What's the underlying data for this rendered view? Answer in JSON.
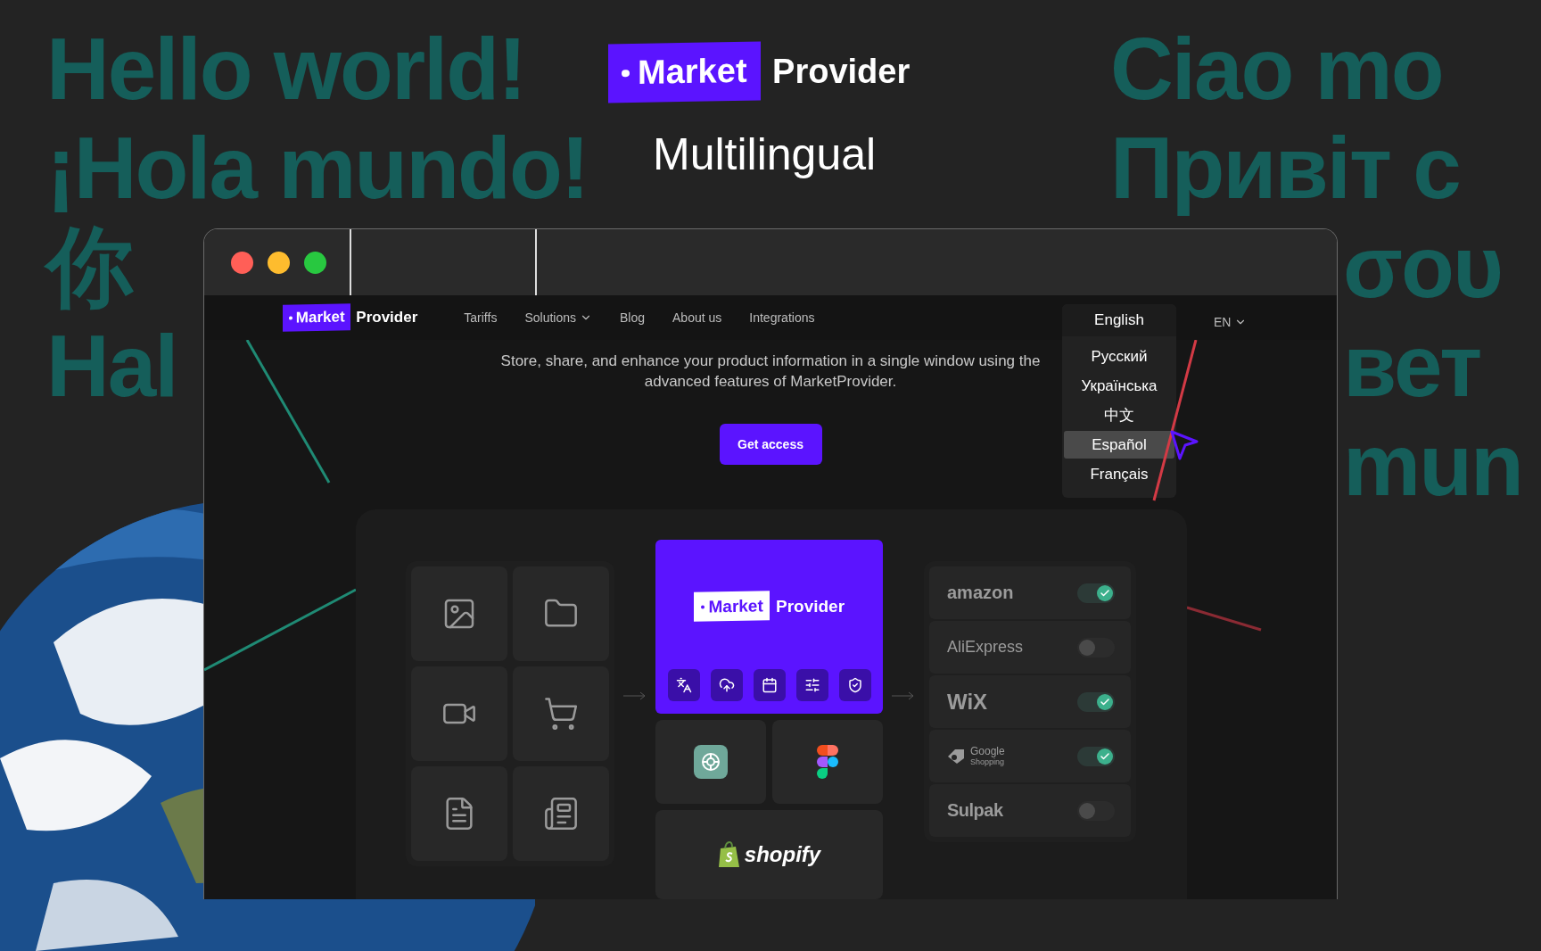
{
  "background_text": {
    "left": [
      "Hello world!",
      "¡Hola mundo!",
      "你",
      "Hal"
    ],
    "right": [
      "Ciao mo",
      "Привіт с"
    ],
    "right_beside_window": [
      "σου",
      "вет",
      "mun"
    ]
  },
  "headline": {
    "brand": {
      "badge": "Market",
      "name": "Provider"
    },
    "subtitle": "Multilingual"
  },
  "window": {
    "nav": {
      "brand": {
        "badge": "Market",
        "name": "Provider"
      },
      "links": [
        {
          "label": "Tariffs",
          "dropdown": false
        },
        {
          "label": "Solutions",
          "dropdown": true
        },
        {
          "label": "Blog",
          "dropdown": false
        },
        {
          "label": "About us",
          "dropdown": false
        },
        {
          "label": "Integrations",
          "dropdown": false
        }
      ],
      "language_menu": {
        "current": "English",
        "options": [
          {
            "label": "Русский",
            "selected": false
          },
          {
            "label": "Українська",
            "selected": false
          },
          {
            "label": "中文",
            "selected": false
          },
          {
            "label": "Español",
            "selected": true
          },
          {
            "label": "Français",
            "selected": false
          }
        ]
      },
      "language_switch": {
        "label": "EN",
        "dropdown": true
      }
    },
    "hero": {
      "text": "Store, share, and enhance your product information in a single window using the advanced features of MarketProvider.",
      "button": "Get access"
    },
    "diagram": {
      "brand": {
        "badge": "Market",
        "name": "Provider"
      },
      "tools": [
        "shopify"
      ],
      "integrations": [
        {
          "kind": "amazon",
          "name": "amazon",
          "on": true
        },
        {
          "kind": "aliexpress",
          "name": "AliExpress",
          "on": false
        },
        {
          "kind": "wix",
          "name": "WiX",
          "on": true
        },
        {
          "kind": "google",
          "name": "Google",
          "sub": "Shopping",
          "on": true
        },
        {
          "kind": "sulpak",
          "name": "Sulpak",
          "on": false
        }
      ]
    }
  }
}
